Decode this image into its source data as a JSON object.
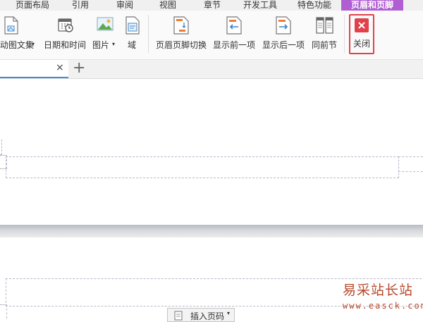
{
  "menu_tabs": [
    "页面布局",
    "引用",
    "审阅",
    "视图",
    "章节",
    "开发工具",
    "特色功能",
    "页眉和页脚"
  ],
  "ribbon": {
    "items": [
      "动图文集",
      "日期和时间",
      "图片",
      "域",
      "页眉页脚切换",
      "显示前一项",
      "显示后一项",
      "同前节",
      "关闭"
    ]
  },
  "doc_tabs": {
    "close_symbol": "×",
    "add_symbol": "+"
  },
  "footer_button": {
    "label": "插入页码"
  },
  "watermark": {
    "text": "易采站长站",
    "url": "www.easck.com"
  },
  "colors": {
    "active_tab": "#b05fd2",
    "close_icon": "#e0414a",
    "highlight_box": "#e0414a",
    "watermark": "#b7482b",
    "doc_tab_underline": "#3f8cd8"
  }
}
